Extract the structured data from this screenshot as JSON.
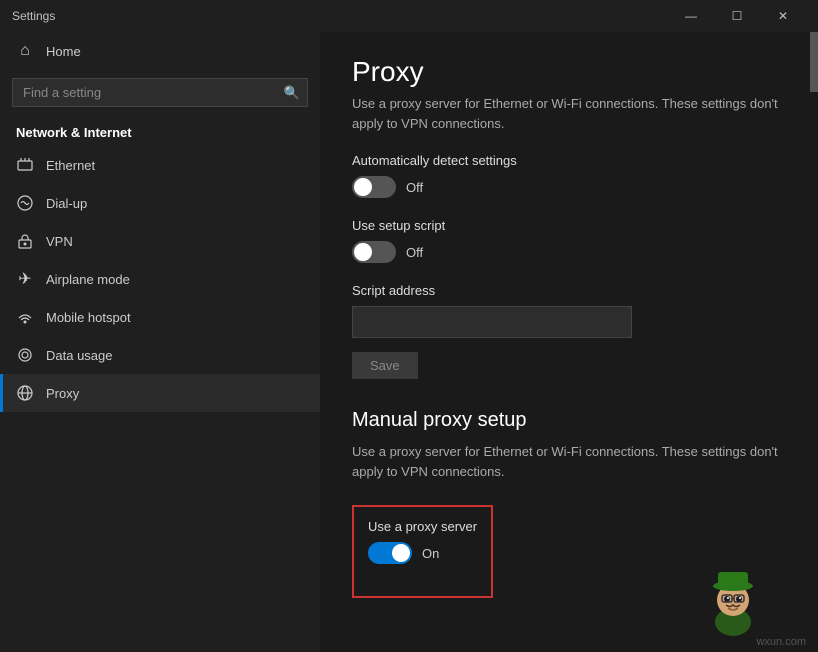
{
  "titlebar": {
    "title": "Settings",
    "minimize": "—",
    "maximize": "☐",
    "close": "✕"
  },
  "sidebar": {
    "header": "Settings",
    "search_placeholder": "Find a setting",
    "home_label": "Home",
    "section_label": "Network & Internet",
    "nav_items": [
      {
        "id": "ethernet",
        "label": "Ethernet",
        "icon": "🖥"
      },
      {
        "id": "dialup",
        "label": "Dial-up",
        "icon": "📞"
      },
      {
        "id": "vpn",
        "label": "VPN",
        "icon": "🔒"
      },
      {
        "id": "airplane",
        "label": "Airplane mode",
        "icon": "✈"
      },
      {
        "id": "hotspot",
        "label": "Mobile hotspot",
        "icon": "📶"
      },
      {
        "id": "datausage",
        "label": "Data usage",
        "icon": "◎"
      },
      {
        "id": "proxy",
        "label": "Proxy",
        "icon": "🌐"
      }
    ]
  },
  "content": {
    "page_title": "Proxy",
    "auto_setup_section": {
      "desc": "Use a proxy server for Ethernet or Wi-Fi connections. These settings don't apply to VPN connections.",
      "auto_detect_label": "Automatically detect settings",
      "auto_detect_state": "Off",
      "setup_script_label": "Use setup script",
      "setup_script_state": "Off",
      "script_address_label": "Script address",
      "script_address_value": "",
      "save_label": "Save"
    },
    "manual_section": {
      "title": "Manual proxy setup",
      "desc": "Use a proxy server for Ethernet or Wi-Fi connections. These settings don't apply to VPN connections.",
      "use_proxy_label": "Use a proxy server",
      "use_proxy_state": "On"
    }
  },
  "watermark": "wxun.com"
}
